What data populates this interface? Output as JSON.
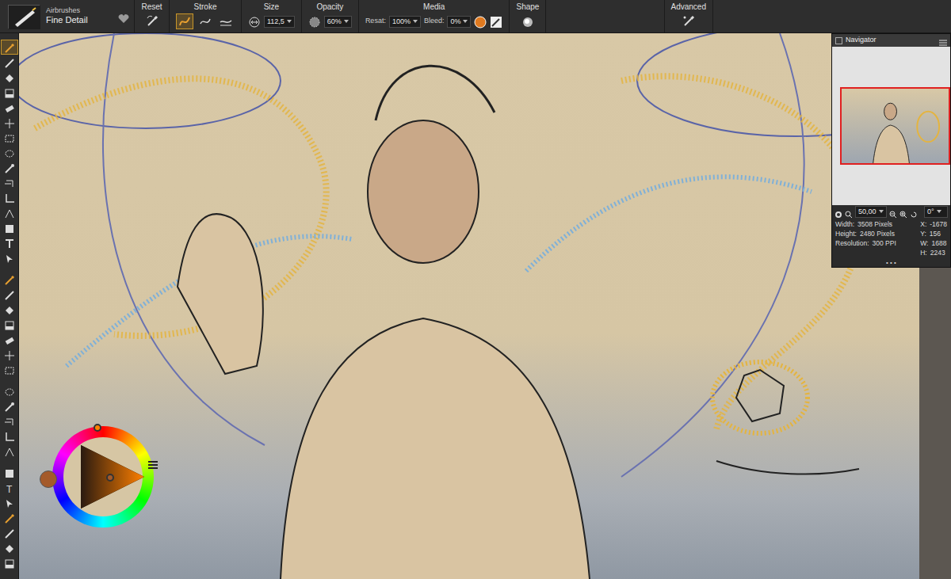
{
  "brush": {
    "category": "Airbrushes",
    "variant": "Fine Detail"
  },
  "property_bar": {
    "reset": {
      "label": "Reset"
    },
    "stroke": {
      "label": "Stroke",
      "modes": [
        {
          "selected": true
        },
        {
          "selected": false
        },
        {
          "selected": false
        }
      ]
    },
    "size": {
      "label": "Size",
      "value": "112,5"
    },
    "opacity": {
      "label": "Opacity",
      "value": "60%"
    },
    "media": {
      "label": "Media",
      "resat_label": "Resat:",
      "resat": "100%",
      "bleed_label": "Bleed:",
      "bleed": "0%"
    },
    "shape": {
      "label": "Shape"
    },
    "advanced": {
      "label": "Advanced"
    }
  },
  "tools": [
    {
      "selected": true
    },
    {
      "selected": false
    },
    {
      "selected": false
    },
    {
      "selected": false
    },
    {
      "selected": false
    },
    {
      "selected": false
    },
    {
      "selected": false
    },
    {
      "selected": false
    },
    {
      "selected": false
    },
    {
      "selected": false
    },
    {
      "selected": false
    },
    {
      "selected": false
    },
    {
      "selected": false
    },
    {
      "selected": false
    },
    {
      "selected": false
    },
    {
      "selected": false
    },
    {
      "selected": false
    },
    {
      "selected": false
    },
    {
      "selected": false
    },
    {
      "selected": false
    },
    {
      "selected": false
    },
    {
      "selected": false
    },
    {
      "selected": false
    },
    {
      "selected": false
    },
    {
      "selected": false
    },
    {
      "selected": false
    },
    {
      "selected": false
    },
    {
      "selected": false
    },
    {
      "selected": false
    },
    {
      "selected": false
    },
    {
      "selected": false
    },
    {
      "selected": false
    },
    {
      "selected": false
    },
    {
      "selected": false
    }
  ],
  "navigator": {
    "title": "Navigator",
    "zoom": "50,00",
    "rotation": "0°",
    "info": [
      {
        "label": "Width:",
        "value": "3508 Pixels"
      },
      {
        "label": "Height:",
        "value": "2480 Pixels"
      },
      {
        "label": "Resolution:",
        "value": "300 PPI"
      }
    ],
    "coords": [
      {
        "label": "X:",
        "value": "-1678"
      },
      {
        "label": "Y:",
        "value": "156"
      },
      {
        "label": "W:",
        "value": "1688"
      },
      {
        "label": "H:",
        "value": "2243"
      }
    ],
    "more": "• • •"
  },
  "color_wheel": {
    "hue_color": "#ff8000",
    "current_color": "#a45a2a"
  }
}
